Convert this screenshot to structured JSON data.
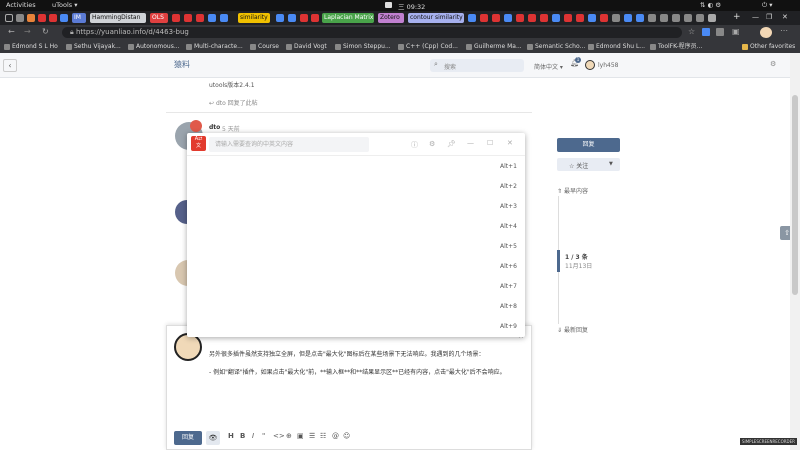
{
  "os": {
    "activities": "Activities",
    "app": "uTools ▾",
    "clock": "三 09:32"
  },
  "tabs": [
    {
      "label": "IM",
      "color": "#5b7bd5"
    },
    {
      "label": "HammingDistan",
      "color": "#cfd2d6"
    },
    {
      "label": "OLS",
      "color": "#e04040"
    },
    {
      "label": "similarity",
      "color": "#f0c000"
    },
    {
      "label": "Laplacian Matrix",
      "color": "#49a34a"
    },
    {
      "label": "Zotero",
      "color": "#c080d0"
    },
    {
      "label": "contour similarity",
      "color": "#a6b0ee"
    }
  ],
  "url": "https://yuanliao.info/d/4463-bug",
  "bookmarks": [
    "Edmond S L Ho",
    "Sethu Vijayak...",
    "Autonomous...",
    "Multi-characte...",
    "Course",
    "David Vogt",
    "Simon Steppu...",
    "C++ (Cpp) Cod...",
    "Guilherme Ma...",
    "Semantic Scho...",
    "Edmond Shu L...",
    "ToolFK-程序员...",
    "Other favorites"
  ],
  "header": {
    "logo": "猿料",
    "search_placeholder": "搜索",
    "lang": "简体中文 ▾",
    "notif_count": "1",
    "username": "lyh458"
  },
  "post": {
    "version_text": "utools版本2.4.1",
    "reply_link": "dto 回复了此帖",
    "author": "dto",
    "time": "5 天前"
  },
  "sidebar": {
    "reply_button": "回复",
    "follow_button": "☆ 关注",
    "jump_latest_top": "最早内容",
    "pager": "1 / 3 条",
    "pager_date": "11月13日",
    "jump_latest_bottom": "最新回复"
  },
  "utools": {
    "placeholder": "请输入需要查询的中英文内容",
    "shortcuts": [
      "Alt+1",
      "Alt+2",
      "Alt+3",
      "Alt+4",
      "Alt+5",
      "Alt+6",
      "Alt+7",
      "Alt+8",
      "Alt+9"
    ]
  },
  "composer": {
    "line1": "另外很多插件虽然支持独立全屏，但是点击\"最大化\"图标后在某些场景下无法响应。我遇到的几个场景：",
    "line2": "- 例如\"翻译\"插件，如果点击\"最大化\"前，**输入框**和**结果显示区**已经有内容，点击\"最大化\"后不会响应。",
    "reply_button": "回复",
    "tools": [
      "H",
      "B",
      "I",
      "\"",
      "<>",
      "⊕",
      "▣",
      "☰",
      "☷",
      "@",
      "☺"
    ]
  },
  "recorder": "SIMPLESCREENRECORDER"
}
